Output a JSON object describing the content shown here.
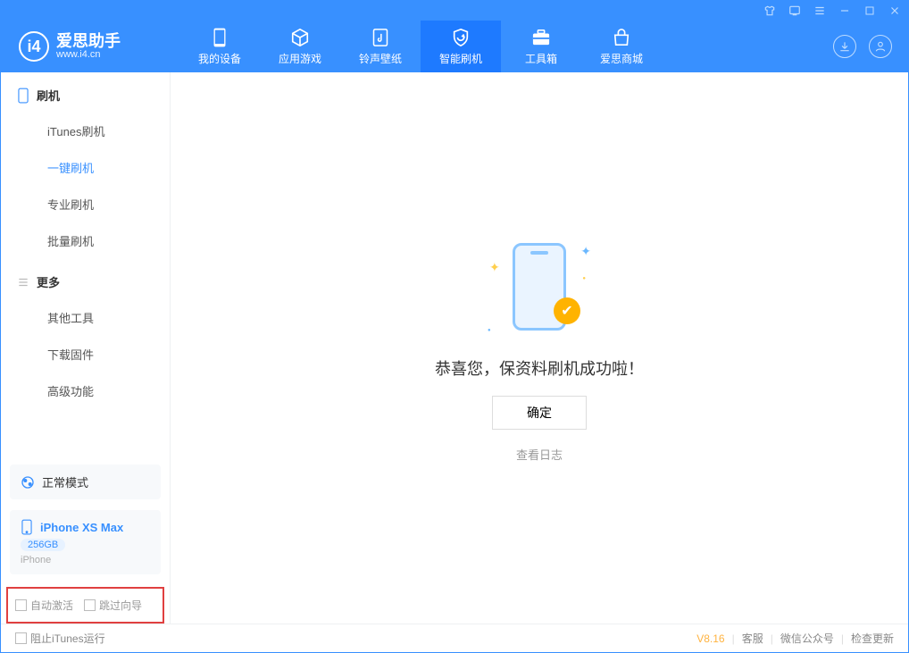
{
  "app": {
    "name": "爱思助手",
    "url": "www.i4.cn"
  },
  "nav": {
    "items": [
      {
        "label": "我的设备"
      },
      {
        "label": "应用游戏"
      },
      {
        "label": "铃声壁纸"
      },
      {
        "label": "智能刷机"
      },
      {
        "label": "工具箱"
      },
      {
        "label": "爱思商城"
      }
    ],
    "activeIndex": 3
  },
  "sidebar": {
    "section1": {
      "title": "刷机",
      "items": [
        "iTunes刷机",
        "一键刷机",
        "专业刷机",
        "批量刷机"
      ],
      "activeIndex": 1
    },
    "section2": {
      "title": "更多",
      "items": [
        "其他工具",
        "下载固件",
        "高级功能"
      ]
    }
  },
  "mode": {
    "label": "正常模式"
  },
  "device": {
    "name": "iPhone XS Max",
    "storage": "256GB",
    "type": "iPhone"
  },
  "options": {
    "autoActivate": "自动激活",
    "skipGuide": "跳过向导"
  },
  "main": {
    "successText": "恭喜您，保资料刷机成功啦！",
    "okLabel": "确定",
    "logLink": "查看日志"
  },
  "footer": {
    "blockItunes": "阻止iTunes运行",
    "version": "V8.16",
    "links": [
      "客服",
      "微信公众号",
      "检查更新"
    ]
  }
}
